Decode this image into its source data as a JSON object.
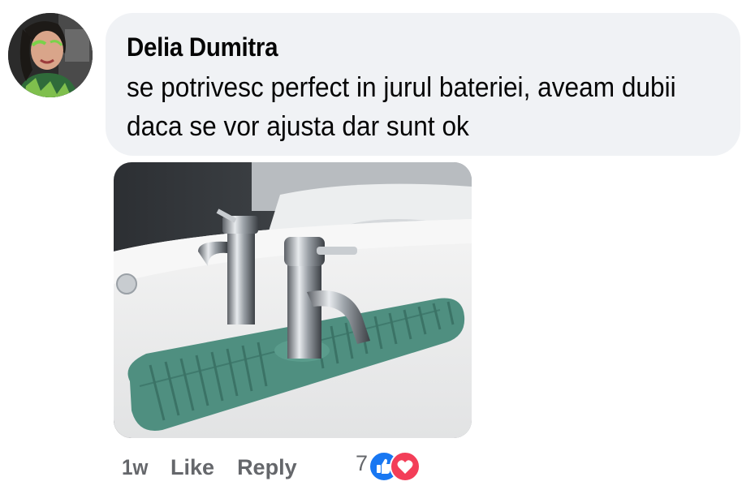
{
  "comment": {
    "author": "Delia Dumitra",
    "text": "se potrivesc perfect in jurul bateriei, aveam dubii daca se vor ajusta dar sunt ok",
    "timestamp": "1w",
    "like_label": "Like",
    "reply_label": "Reply",
    "reaction_count": "7",
    "reactions": [
      "like-icon",
      "love-icon"
    ]
  },
  "colors": {
    "bubble_bg": "#f0f2f5",
    "text": "#050505",
    "meta_text": "#65676b",
    "like_blue": "#1877f2",
    "love_red": "#f33e58",
    "mat_green": "#4f8f80"
  }
}
